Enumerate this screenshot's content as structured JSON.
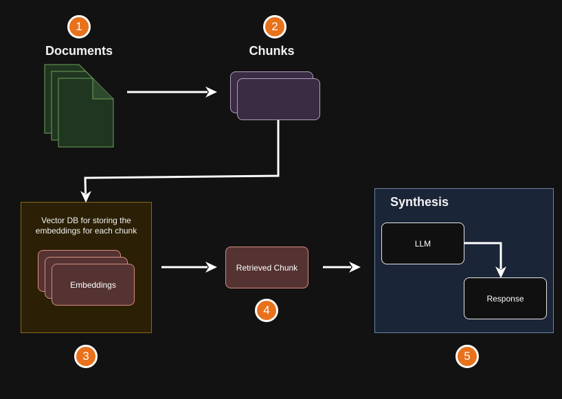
{
  "steps": {
    "documents": {
      "number": "1",
      "label": "Documents"
    },
    "chunks": {
      "number": "2",
      "label": "Chunks"
    },
    "vector_db": {
      "number": "3",
      "description": "Vector DB for storing the embeddings for each chunk",
      "embeddings_label": "Embeddings"
    },
    "retrieval": {
      "number": "4",
      "label": "Retrieved Chunk"
    },
    "synthesis": {
      "number": "5",
      "title": "Synthesis",
      "llm_label": "LLM",
      "response_label": "Response"
    }
  },
  "colors": {
    "background": "#121212",
    "badge": "#e8711c",
    "document_fill": "#203620",
    "document_stroke": "#6fa35a",
    "chunk_fill": "#3a2c42",
    "embedding_fill": "#553333",
    "vector_db_fill": "#2b2005",
    "synthesis_fill": "#1b2538",
    "arrow": "#ffffff"
  }
}
